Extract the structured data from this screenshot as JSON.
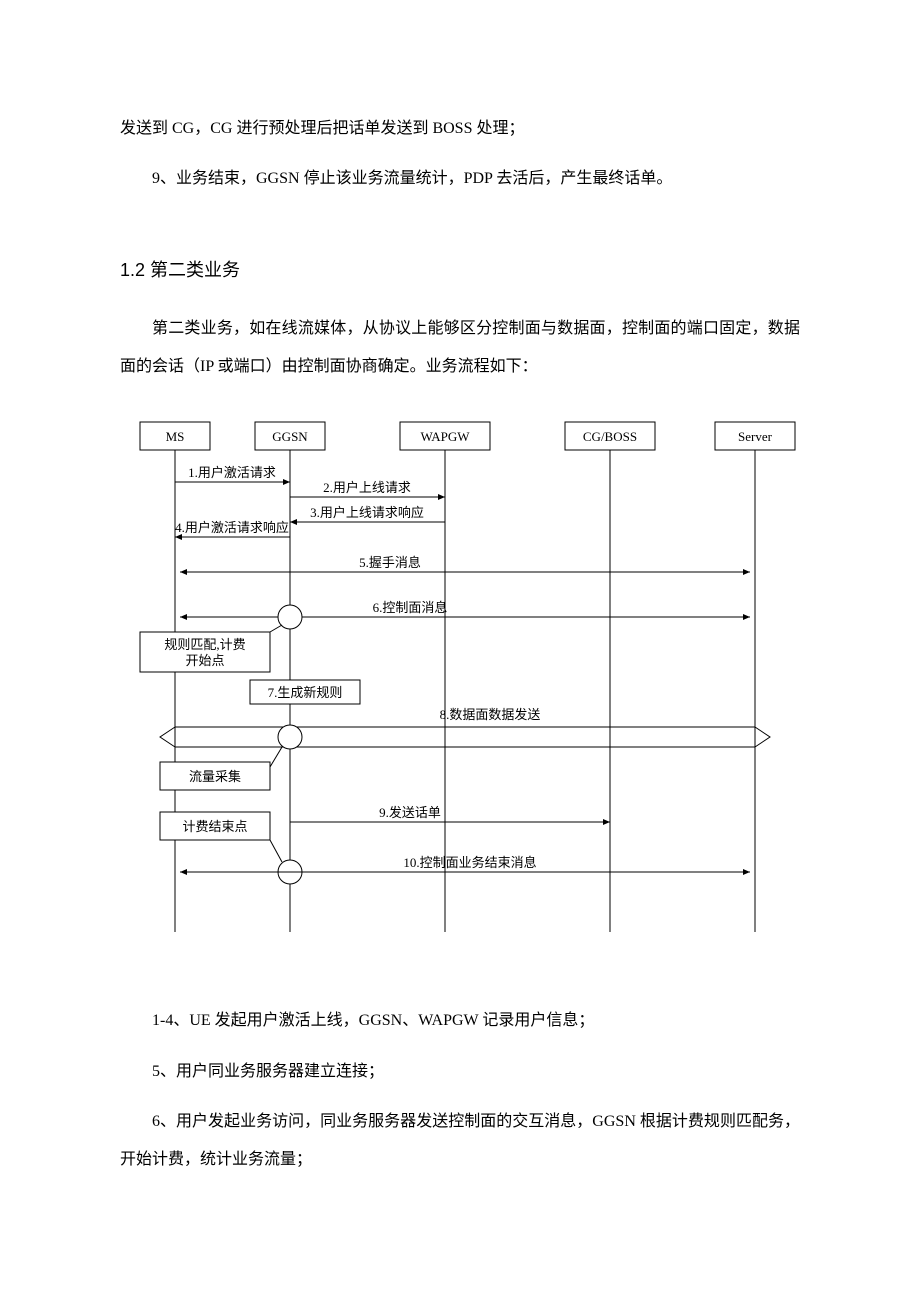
{
  "paragraphs": {
    "p1": "发送到 CG，CG 进行预处理后把话单发送到 BOSS 处理；",
    "p2": "9、业务结束，GGSN 停止该业务流量统计，PDP 去活后，产生最终话单。",
    "p3": "第二类业务，如在线流媒体，从协议上能够区分控制面与数据面，控制面的端口固定，数据面的会话（IP 或端口）由控制面协商确定。业务流程如下：",
    "p4": "1-4、UE 发起用户激活上线，GGSN、WAPGW 记录用户信息；",
    "p5": "5、用户同业务服务器建立连接；",
    "p6": "6、用户发起业务访问，同业务服务器发送控制面的交互消息，GGSN 根据计费规则匹配务，开始计费，统计业务流量；"
  },
  "heading": "1.2 第二类业务",
  "diagram": {
    "actors": {
      "ms": "MS",
      "ggsn": "GGSN",
      "wapgw": "WAPGW",
      "cgboss": "CG/BOSS",
      "server": "Server"
    },
    "messages": {
      "m1": "1.用户激活请求",
      "m2": "2.用户上线请求",
      "m3": "3.用户上线请求响应",
      "m4": "4.用户激活请求响应",
      "m5": "5.握手消息",
      "m6": "6.控制面消息",
      "m7": "7.生成新规则",
      "m8": "8.数据面数据发送",
      "m9": "9.发送话单",
      "m10": "10.控制面业务结束消息"
    },
    "notes": {
      "n1a": "规则匹配,计费",
      "n1b": "开始点",
      "n2": "流量采集",
      "n3": "计费结束点"
    }
  }
}
